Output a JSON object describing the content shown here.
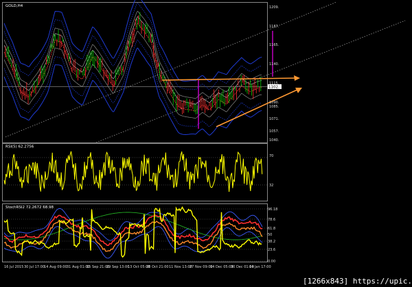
{
  "window": {
    "title": "GOLD,H4"
  },
  "panes": {
    "main": {
      "price_labels": [
        "1209.",
        "1187.",
        "1165.",
        "1140.",
        "1115.",
        "1112.",
        "1090.",
        "1085.",
        "1071.",
        "1057.",
        "1040."
      ],
      "current_price": "1102."
    },
    "rsi": {
      "title": "RSI(5) 62.2756",
      "levels": [
        "70",
        "32"
      ]
    },
    "stoch": {
      "title": "StochRSI2 72.2672 68.98",
      "levels": [
        "96.18",
        "78.6",
        "61.8",
        "50",
        "38.2",
        "23.6",
        "0.00"
      ]
    }
  },
  "time_axis": [
    "16 Jul 2015",
    "30 Jul 17:00",
    "14 Aug 09:00",
    "31 Aug 01:00",
    "15 Sep 21:00",
    "29 Sep 13:00",
    "13 Oct 05:00",
    "28 Oct 21:00",
    "11 Nov 13:00",
    "27 Nov 09:00",
    "14 Dec 05:00",
    "30 Dec 01:00",
    "14 Jan 17:00"
  ],
  "watermark": "[1266x843] https://upic.me/",
  "colors": {
    "rsi_line": "#ffff00",
    "stoch_line": "#ffff00",
    "arrow": "#ff9933",
    "vertical_marker": "#cc00cc",
    "bands_outer": "#1f3bd6",
    "bands_inner": "#8a8a8a",
    "candle_up": "#00cc00",
    "candle_down": "#ff3030",
    "ma_red": "#ff3b3b"
  }
}
